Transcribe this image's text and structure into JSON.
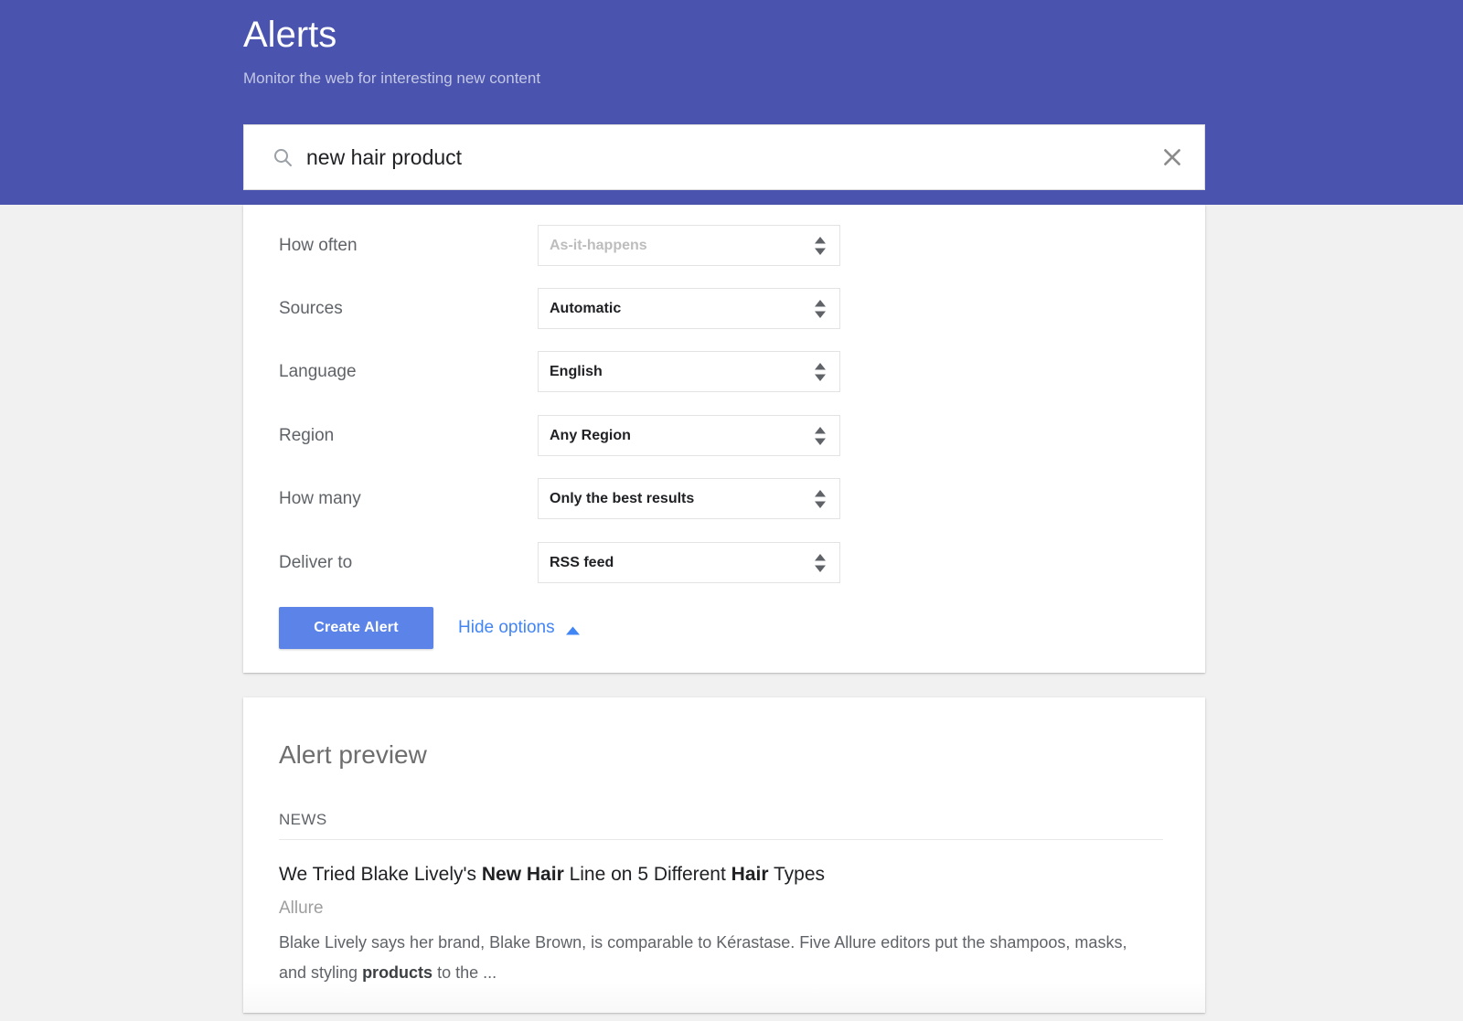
{
  "header": {
    "title": "Alerts",
    "subtitle": "Monitor the web for interesting new content",
    "bg_color": "#4a54ae"
  },
  "search": {
    "value": "new hair product",
    "placeholder": "Create an alert about...",
    "search_icon": "search-icon",
    "clear_icon": "close-icon"
  },
  "options": {
    "rows": [
      {
        "label": "How often",
        "value": "As-it-happens",
        "muted": true
      },
      {
        "label": "Sources",
        "value": "Automatic",
        "muted": false
      },
      {
        "label": "Language",
        "value": "English",
        "muted": false
      },
      {
        "label": "Region",
        "value": "Any Region",
        "muted": false
      },
      {
        "label": "How many",
        "value": "Only the best results",
        "muted": false
      },
      {
        "label": "Deliver to",
        "value": "RSS feed",
        "muted": false
      }
    ],
    "create_button": "Create Alert",
    "hide_options": "Hide options",
    "hide_options_icon": "caret-up-icon",
    "accent_color": "#5b83e8",
    "link_color": "#4285f4"
  },
  "preview": {
    "title": "Alert preview",
    "section_label": "NEWS",
    "results": [
      {
        "headline_parts": [
          {
            "text": "We Tried Blake Lively's ",
            "bold": false
          },
          {
            "text": "New Hair",
            "bold": true
          },
          {
            "text": " Line on 5 Different ",
            "bold": false
          },
          {
            "text": "Hair",
            "bold": true
          },
          {
            "text": " Types",
            "bold": false
          }
        ],
        "headline_plain": "We Tried Blake Lively's New Hair Line on 5 Different Hair Types",
        "source": "Allure",
        "snippet_parts": [
          {
            "text": "Blake Lively says her brand, Blake Brown, is comparable to Kérastase. Five Allure editors put the shampoos, masks, and styling ",
            "bold": false
          },
          {
            "text": "products",
            "bold": true
          },
          {
            "text": " to the ...",
            "bold": false
          }
        ],
        "snippet_plain": "Blake Lively says her brand, Blake Brown, is comparable to Kérastase. Five Allure editors put the shampoos, masks, and styling products to the ..."
      }
    ]
  }
}
